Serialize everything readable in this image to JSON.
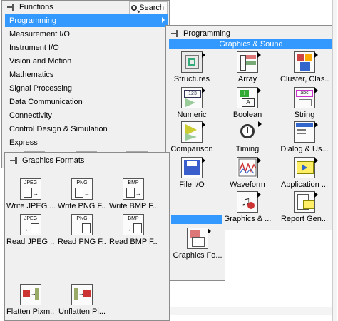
{
  "functions_palette": {
    "title": "Functions",
    "search_label": "Search",
    "items": [
      {
        "label": "Programming",
        "selected": true,
        "submenu": true
      },
      {
        "label": "Measurement I/O"
      },
      {
        "label": "Instrument I/O"
      },
      {
        "label": "Vision and Motion"
      },
      {
        "label": "Mathematics"
      },
      {
        "label": "Signal Processing"
      },
      {
        "label": "Data Communication"
      },
      {
        "label": "Connectivity"
      },
      {
        "label": "Control Design & Simulation"
      },
      {
        "label": "Express"
      }
    ]
  },
  "programming_palette": {
    "title": "Programming",
    "subtitle": "Graphics & Sound",
    "tiles": [
      {
        "label": "Structures",
        "icon": "structures-icon"
      },
      {
        "label": "Array",
        "icon": "array-icon"
      },
      {
        "label": "Cluster, Clas...",
        "icon": "cluster-icon"
      },
      {
        "label": "Numeric",
        "icon": "numeric-icon"
      },
      {
        "label": "Boolean",
        "icon": "boolean-icon"
      },
      {
        "label": "String",
        "icon": "string-icon"
      },
      {
        "label": "Comparison",
        "icon": "comparison-icon"
      },
      {
        "label": "Timing",
        "icon": "timing-icon"
      },
      {
        "label": "Dialog & Us...",
        "icon": "dialog-icon"
      },
      {
        "label": "File I/O",
        "icon": "file-io-icon"
      },
      {
        "label": "Waveform",
        "icon": "waveform-icon"
      },
      {
        "label": "Application ...",
        "icon": "application-icon"
      },
      {
        "label": "Graphics & ...",
        "icon": "graphics-sound-icon"
      },
      {
        "label": "Report Gen...",
        "icon": "report-gen-icon"
      }
    ]
  },
  "graphics_sound_palette": {
    "tile_label": "Graphics Fo..."
  },
  "graphics_formats_palette": {
    "title": "Graphics Formats",
    "tiles": [
      {
        "label": "Write JPEG ...",
        "icon_text": "JPEG"
      },
      {
        "label": "Write PNG F...",
        "icon_text": "PNG"
      },
      {
        "label": "Write BMP F...",
        "icon_text": "BMP"
      },
      {
        "label": "Read JPEG ...",
        "icon_text": "JPEG"
      },
      {
        "label": "Read PNG F...",
        "icon_text": "PNG"
      },
      {
        "label": "Read BMP F...",
        "icon_text": "BMP"
      },
      {
        "label": "Flatten Pixm...",
        "icon_text": ""
      },
      {
        "label": "Unflatten Pi...",
        "icon_text": ""
      }
    ]
  },
  "colors": {
    "selection": "#3399ff",
    "palette_bg": "#f0f0f0"
  }
}
